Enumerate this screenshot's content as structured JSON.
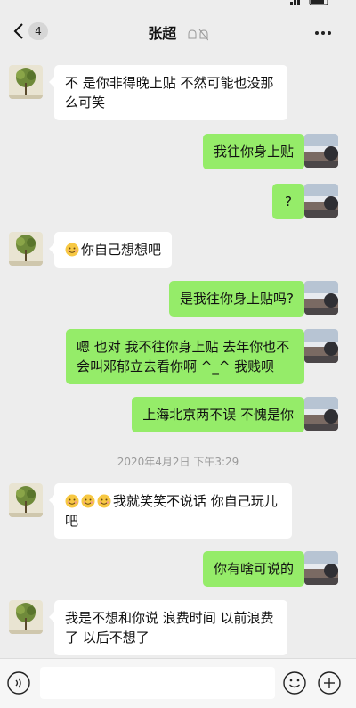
{
  "header": {
    "back_badge": "4",
    "title": "张超"
  },
  "messages": [
    {
      "side": "left",
      "text": "不 是你非得晚上贴 不然可能也没那么可笑"
    },
    {
      "side": "right",
      "text": "我往你身上贴"
    },
    {
      "side": "right",
      "text": "?"
    },
    {
      "side": "left",
      "text": "你自己想想吧",
      "emoji_count": 1
    },
    {
      "side": "right",
      "text": "是我往你身上贴吗?"
    },
    {
      "side": "right",
      "text": "嗯 也对 我不往你身上贴 去年你也不会叫邓郁立去看你啊 ^_^ 我贱呗"
    },
    {
      "side": "right",
      "text": "上海北京两不误 不愧是你"
    },
    {
      "side": "left",
      "text": "我就笑笑不说话 你自己玩儿吧",
      "emoji_count": 3
    },
    {
      "side": "right",
      "text": "你有啥可说的"
    },
    {
      "side": "left",
      "text": "我是不想和你说 浪费时间 以前浪费了 以后不想了"
    }
  ],
  "timestamp": "2020年4月2日 下午3:29",
  "input": {
    "placeholder": ""
  },
  "icons": {
    "back": "chevron-left-icon",
    "mute": "mute-bell-icon",
    "more": "more-dots-icon",
    "voice": "voice-icon",
    "emoji": "smiley-icon",
    "plus": "plus-circle-icon"
  },
  "colors": {
    "background": "#ededed",
    "self_bubble": "#95ec69",
    "other_bubble": "#ffffff"
  }
}
